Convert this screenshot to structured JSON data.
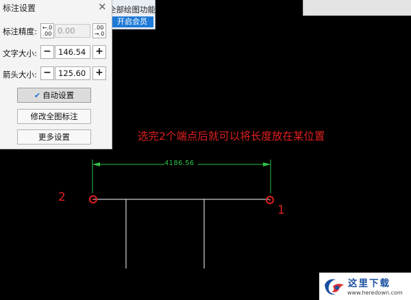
{
  "vip_banner": {
    "text": "全部绘图功能",
    "button": "开启会员"
  },
  "panel": {
    "title": "标注设置",
    "close": "✕",
    "precision": {
      "label": "标注精度:",
      "dec_left_top": "←.0",
      "dec_left_bottom": ".00",
      "value": "0.00",
      "dec_right_top": ".00",
      "dec_right_bottom": "→.0"
    },
    "text_size": {
      "label": "文字大小:",
      "minus": "−",
      "value": "146.54",
      "plus": "+"
    },
    "arrow_size": {
      "label": "箭头大小:",
      "minus": "−",
      "value": "125.60",
      "plus": "+"
    },
    "auto_button": {
      "check": "✔",
      "label": "自动设置"
    },
    "modify_button": "修改全图标注",
    "more_button": "更多设置"
  },
  "drawing": {
    "annotation": "选完2个端点后就可以将长度放在某位置",
    "dimension_text": "4186.56",
    "point_left": "2",
    "point_right": "1",
    "colors": {
      "dimension": "#2fc24a",
      "marker": "#e02020",
      "lines": "#ffffff"
    }
  },
  "watermark": {
    "brand": "这里下载",
    "url": "www.heredown.com"
  }
}
